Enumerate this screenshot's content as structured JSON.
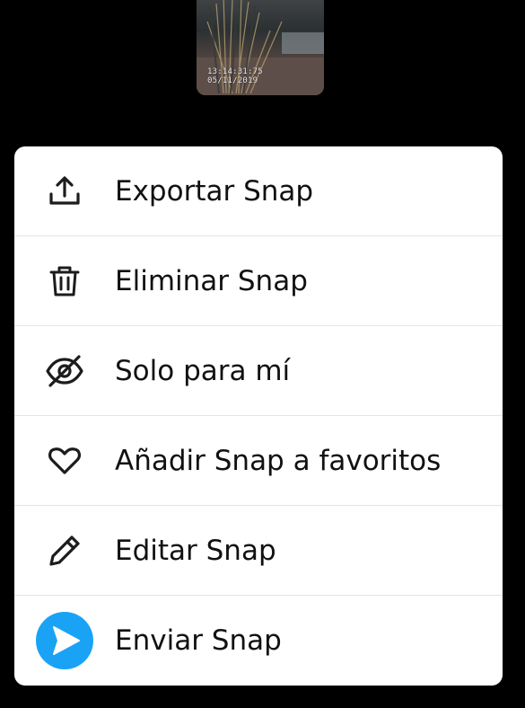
{
  "thumbnail": {
    "timestamp_time": "13:14:31:75",
    "timestamp_date": "05/11/2019"
  },
  "menu": {
    "items": [
      {
        "label": "Exportar Snap",
        "icon": "export-icon"
      },
      {
        "label": "Eliminar Snap",
        "icon": "trash-icon"
      },
      {
        "label": "Solo para mí",
        "icon": "eye-slash-icon"
      },
      {
        "label": "Añadir Snap a favoritos",
        "icon": "heart-icon"
      },
      {
        "label": "Editar Snap",
        "icon": "pencil-icon"
      },
      {
        "label": "Enviar Snap",
        "icon": "send-icon"
      }
    ]
  },
  "colors": {
    "background": "#000000",
    "sheet": "#ffffff",
    "text": "#111111",
    "icon": "#1c1c1c",
    "send_accent": "#1aa3f5"
  }
}
